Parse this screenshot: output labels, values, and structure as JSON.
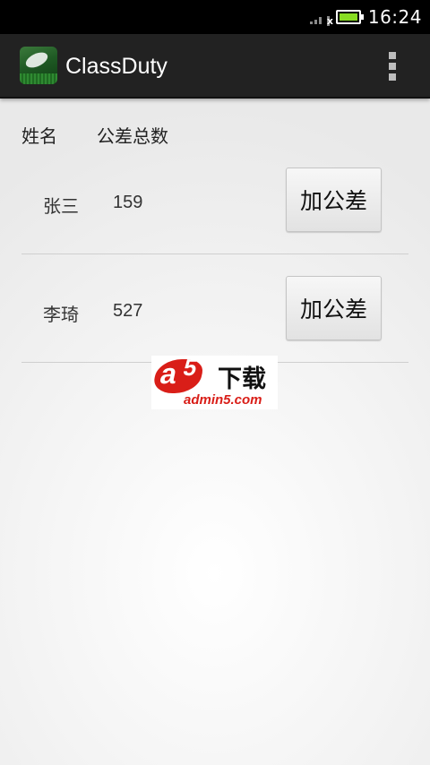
{
  "status_bar": {
    "time": "16:24",
    "signal_icon": "signal-weak-icon",
    "battery_icon": "battery-full-icon",
    "battery_color": "#88dd22"
  },
  "action_bar": {
    "title": "ClassDuty",
    "app_icon": "app-icon",
    "menu_icon": "overflow-menu-icon",
    "background": "#222222"
  },
  "table": {
    "headers": {
      "name": "姓名",
      "duty_total": "公差总数"
    },
    "rows": [
      {
        "name": "张三",
        "count": "159",
        "button_label": "加公差"
      },
      {
        "name": "李琦",
        "count": "527",
        "button_label": "加公差"
      }
    ]
  },
  "watermark": {
    "brand_cn": "下载",
    "url": "admin5.com",
    "brand_color": "#d91e18",
    "logo_lettering": "a5"
  }
}
